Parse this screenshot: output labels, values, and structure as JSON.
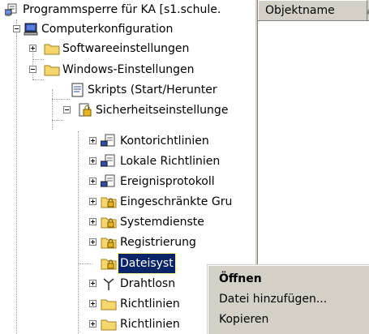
{
  "tree": {
    "items": [
      {
        "label": "Programmsperre für KA [s1.schule.",
        "icon": "policy-computer-icon",
        "expander": "none"
      },
      {
        "label": "Computerkonfiguration",
        "icon": "computer-icon",
        "expander": "minus"
      },
      {
        "label": "Softwareeinstellungen",
        "icon": "folder-icon",
        "expander": "plus"
      },
      {
        "label": "Windows-Einstellungen",
        "icon": "folder-icon",
        "expander": "minus"
      },
      {
        "label": "Skripts (Start/Herunter",
        "icon": "script-icon",
        "expander": "none"
      },
      {
        "label": "Sicherheitseinstellunge",
        "icon": "security-icon",
        "expander": "minus"
      },
      {
        "label": "Kontorichtlinien",
        "icon": "policy-icon",
        "expander": "plus"
      },
      {
        "label": "Lokale Richtlinien",
        "icon": "policy-icon",
        "expander": "plus"
      },
      {
        "label": "Ereignisprotokoll",
        "icon": "policy-icon",
        "expander": "plus"
      },
      {
        "label": "Eingeschränkte Gru",
        "icon": "locked-folder-icon",
        "expander": "plus"
      },
      {
        "label": "Systemdienste",
        "icon": "locked-folder-icon",
        "expander": "plus"
      },
      {
        "label": "Registrierung",
        "icon": "locked-folder-icon",
        "expander": "plus"
      },
      {
        "label": "Dateisyst",
        "icon": "locked-folder-icon",
        "expander": "none",
        "selected": true
      },
      {
        "label": "Drahtlosn",
        "icon": "antenna-icon",
        "expander": "plus"
      },
      {
        "label": "Richtlinien",
        "icon": "folder-icon",
        "expander": "plus"
      },
      {
        "label": "Richtlinien",
        "icon": "folder-icon",
        "expander": "plus"
      }
    ]
  },
  "list": {
    "column_header": "Objektname",
    "sort_indicator": "sort-ascending-icon"
  },
  "context_menu": {
    "items": [
      "Öffnen",
      "Datei hinzufügen...",
      "Kopieren"
    ]
  },
  "colors": {
    "selection": "#0a246a",
    "face": "#d4d0c8",
    "folder": "#f5d76e"
  }
}
